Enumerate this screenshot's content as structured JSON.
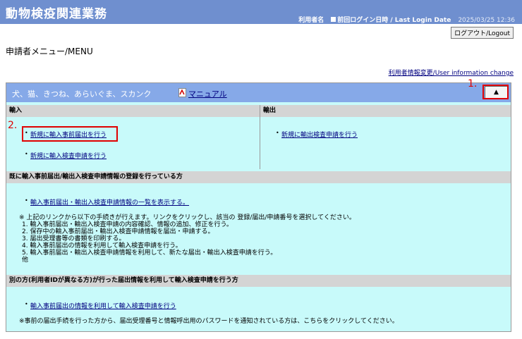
{
  "header": {
    "app_title": "動物検疫関連業務",
    "user_label": "利用者名",
    "last_login_label": "前回ログイン日時 / Last Login Date",
    "last_login_date": "2025/03/25 12:36",
    "logout_label": "ログアウト/Logout"
  },
  "page_title": "申請者メニュー/MENU",
  "user_info_link": "利用者情報変更/User information change",
  "panel": {
    "category": "犬、猫、きつね、あらいぐま、スカンク",
    "manual_link": "マニュアル",
    "collapse_symbol": "▲",
    "import_header": "輸入",
    "export_header": "輸出",
    "import_links": [
      "新規に輸入事前届出を行う",
      "新規に輸入検査申請を行う"
    ],
    "export_links": [
      "新規に輸出検査申請を行う"
    ],
    "registered_header": "既に輸入事前届出/輸出入検査申請情報の登録を行っている方",
    "registered_link": "輸入事前届出・輸出入検査申請情報の一覧を表示する。",
    "notes": [
      "※ 上記のリンクから以下の手続きが行えます。リンクをクリックし、該当の 登録/届出/申請番号を選択してください。",
      "1. 輸入事前届出・輸出入検査申請の内容確認、情報の追加、修正を行う。",
      "2. 保存中の輸入事前届出・輸出入検査申請情報を届出・申請する。",
      "3. 届出受理書等の書類を印刷する。",
      "4. 輸入事前届出の情報を利用して輸入検査申請を行う。",
      "5. 輸入事前届出・輸出入検査申請情報を利用して、新たな届出・輸出入検査申請を行う。",
      "他"
    ],
    "other_header": "別の方(利用者IDが異なる方)が行った届出情報を利用して輸入検査申請を行う方",
    "other_link": "輸入事前届出の情報を利用して輸入検査申請を行う",
    "other_note": "※事前の届出手続を行った方から、届出受理番号と情報呼出用のパスワードを通知されている方は、こちらをクリックしてください。"
  },
  "annotations": {
    "label1": "1.",
    "label2": "2."
  },
  "colors": {
    "header_bg": "#6f8fcf",
    "panel_head_bg": "#86a9e8",
    "panel_bg": "#c8fafa",
    "highlight": "#e00000"
  }
}
